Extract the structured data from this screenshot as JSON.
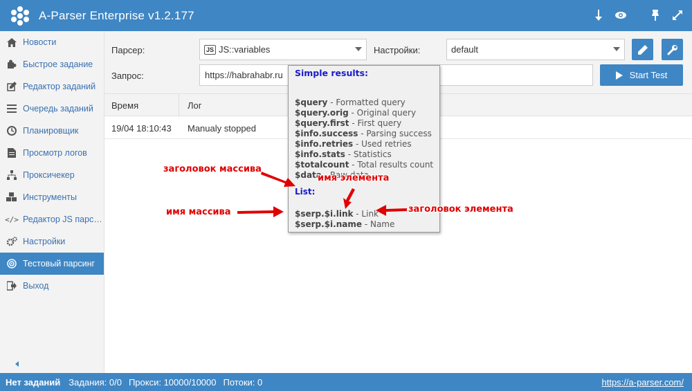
{
  "header": {
    "title": "A-Parser Enterprise v1.2.177",
    "icons": [
      "download-icon",
      "eye-icon",
      "pin-icon",
      "expand-icon"
    ]
  },
  "sidebar": {
    "items": [
      {
        "label": "Новости",
        "icon": "home-icon"
      },
      {
        "label": "Быстрое задание",
        "icon": "puzzle-icon"
      },
      {
        "label": "Редактор заданий",
        "icon": "edit-icon"
      },
      {
        "label": "Очередь заданий",
        "icon": "list-icon"
      },
      {
        "label": "Планировщик",
        "icon": "clock-icon"
      },
      {
        "label": "Просмотр логов",
        "icon": "file-icon"
      },
      {
        "label": "Проксичекер",
        "icon": "sitemap-icon"
      },
      {
        "label": "Инструменты",
        "icon": "cubes-icon"
      },
      {
        "label": "Редактор JS парс…",
        "icon": "code-icon"
      },
      {
        "label": "Настройки",
        "icon": "cogs-icon"
      },
      {
        "label": "Тестовый парсинг",
        "icon": "target-icon",
        "active": true
      },
      {
        "label": "Выход",
        "icon": "exit-icon"
      }
    ]
  },
  "form": {
    "parser_label": "Парсер:",
    "parser_badge": "JS",
    "parser_value": "JS::variables",
    "settings_label": "Настройки:",
    "settings_value": "default",
    "query_label": "Запрос:",
    "query_value": "https://habrahabr.ru",
    "start_label": "Start Test"
  },
  "table": {
    "headers": [
      "Время",
      "Лог"
    ],
    "rows": [
      {
        "time": "19/04 18:10:43",
        "log": "Manualy stopped"
      }
    ]
  },
  "tooltip": {
    "title": "Simple results:",
    "simple": [
      {
        "var": "$query",
        "desc": " - Formatted query"
      },
      {
        "var": "$query.orig",
        "desc": " - Original query"
      },
      {
        "var": "$query.first",
        "desc": " - First query"
      },
      {
        "var": "$info.success",
        "desc": " - Parsing success"
      },
      {
        "var": "$info.retries",
        "desc": " - Used retries"
      },
      {
        "var": "$info.stats",
        "desc": " - Statistics"
      },
      {
        "var": "$totalcount",
        "desc": " - Total results count"
      },
      {
        "var": "$data",
        "desc": " - Raw data"
      }
    ],
    "list_title": "List:",
    "list": [
      {
        "var": "$serp.$i.link",
        "desc": " - Link"
      },
      {
        "var": "$serp.$i.name",
        "desc": " - Name"
      }
    ]
  },
  "annotations": {
    "array_header": "заголовок массива",
    "element_name": "имя элемента",
    "array_name": "имя массива",
    "element_header": "заголовок элемента"
  },
  "statusbar": {
    "no_tasks": "Нет заданий",
    "tasks": "Задания: 0/0",
    "proxies": "Прокси: 10000/10000",
    "threads": "Потоки: 0",
    "link": "https://a-parser.com/"
  },
  "colors": {
    "accent": "#3f86c4",
    "annotation": "#e00000",
    "tooltip_title": "#1a1ad0"
  }
}
